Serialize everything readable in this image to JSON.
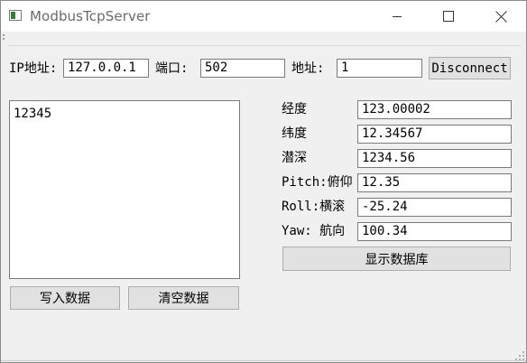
{
  "window": {
    "title": "ModbusTcpServer"
  },
  "titlebar_icons": {
    "app": "app-window-icon",
    "minimize": "minimize-icon",
    "maximize": "maximize-icon",
    "close": "close-icon"
  },
  "connection": {
    "ip_label": "IP地址:",
    "ip_value": "127.0.0.1",
    "port_label": "端口:",
    "port_value": "502",
    "address_label": "地址:",
    "address_value": "1",
    "disconnect_label": "Disconnect"
  },
  "log_area": {
    "content": "12345"
  },
  "actions": {
    "write_label": "写入数据",
    "clear_label": "清空数据"
  },
  "telemetry": {
    "fields": [
      {
        "label": "经度",
        "value": "123.00002"
      },
      {
        "label": "纬度",
        "value": "12.34567"
      },
      {
        "label": "潜深",
        "value": "1234.56"
      },
      {
        "label": "Pitch:俯仰",
        "value": "12.35"
      },
      {
        "label": "Roll:横滚",
        "value": "-25.24"
      },
      {
        "label": "Yaw: 航向",
        "value": "100.34"
      }
    ],
    "show_db_label": "显示数据库"
  },
  "colors": {
    "window_bg": "#f0f0f0",
    "titlebar_bg": "#ffffff",
    "button_bg": "#e1e1e1",
    "field_border": "#7a7a7a"
  }
}
